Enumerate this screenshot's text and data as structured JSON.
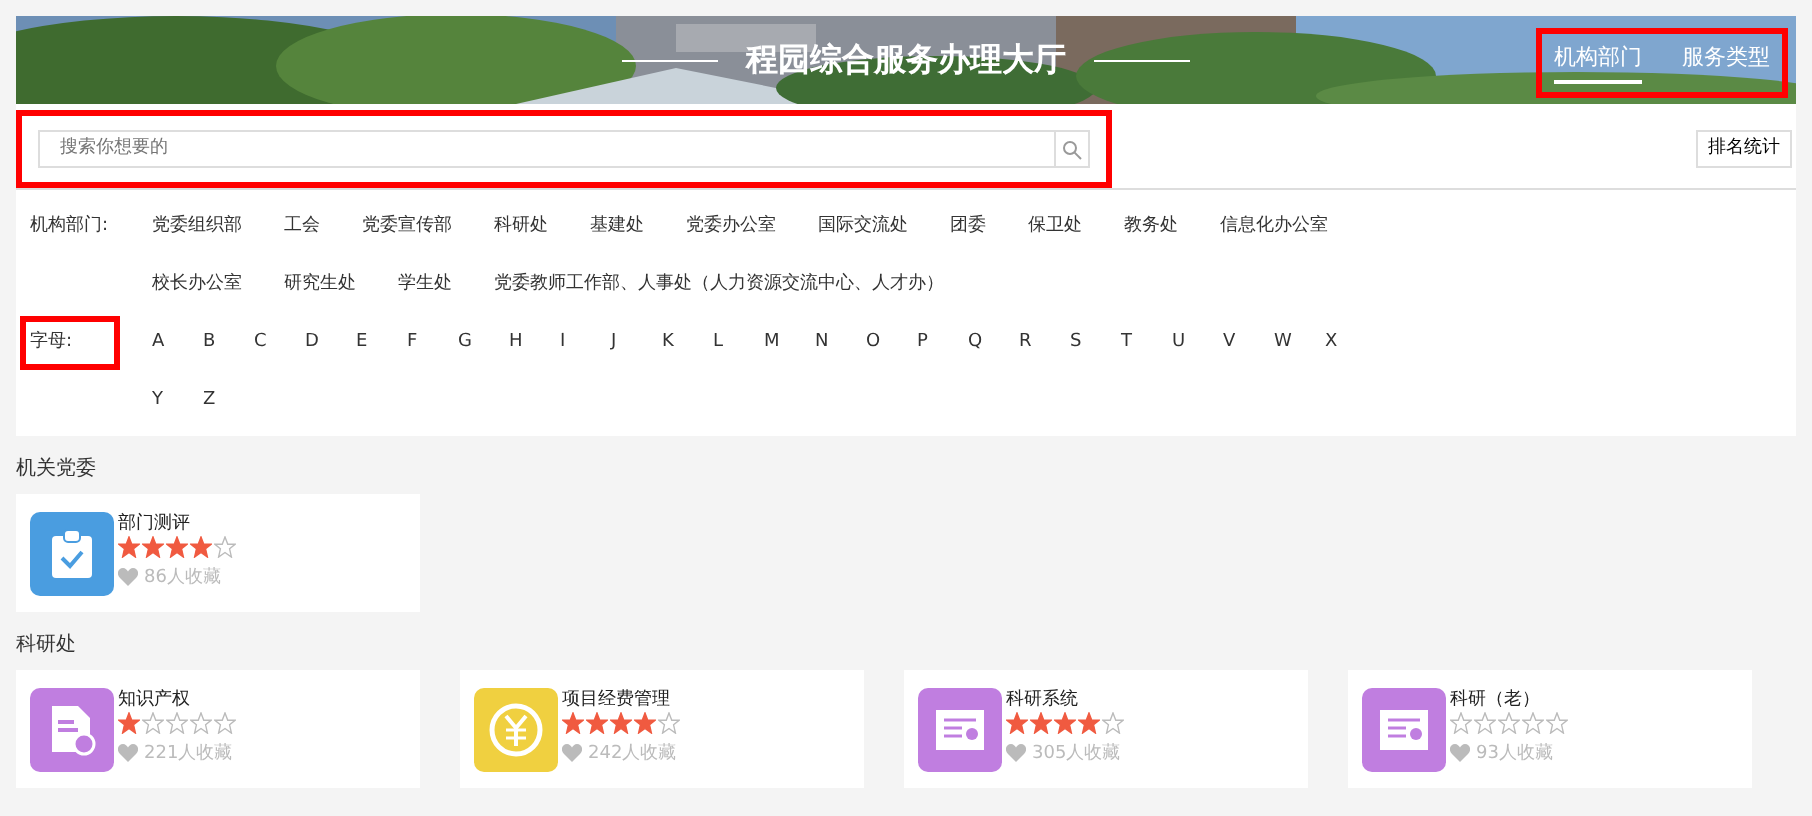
{
  "header": {
    "title": "程园综合服务办理大厅",
    "nav": [
      {
        "label": "机构部门",
        "selected": true
      },
      {
        "label": "服务类型",
        "selected": false
      }
    ],
    "nav_highlighted": true
  },
  "search": {
    "placeholder": "搜索你想要的",
    "highlighted": true
  },
  "ranking_button": "排名统计",
  "filters": [
    {
      "label": "机构部门:",
      "highlighted": false,
      "rows": [
        [
          "党委组织部",
          "工会",
          "党委宣传部",
          "科研处",
          "基建处",
          "党委办公室",
          "国际交流处",
          "团委",
          "保卫处",
          "教务处",
          "信息化办公室"
        ],
        [
          "校长办公室",
          "研究生处",
          "学生处",
          "党委教师工作部、人事处（人力资源交流中心、人才办）"
        ]
      ]
    },
    {
      "label": "字母:",
      "highlighted": true,
      "rows": [
        [
          "A",
          "B",
          "C",
          "D",
          "E",
          "F",
          "G",
          "H",
          "I",
          "J",
          "K",
          "L",
          "M",
          "N",
          "O",
          "P",
          "Q",
          "R",
          "S",
          "T",
          "U",
          "V",
          "W",
          "X"
        ],
        [
          "Y",
          "Z"
        ]
      ]
    }
  ],
  "sections": [
    {
      "title": "机关党委",
      "services": [
        {
          "name": "部门测评",
          "kind": "clipboard",
          "color": "#4a9de0",
          "stars": 4,
          "favorites": "86人收藏"
        }
      ]
    },
    {
      "title": "科研处",
      "services": [
        {
          "name": "知识产权",
          "kind": "document",
          "color": "#c07ee0",
          "stars": 1,
          "favorites": "221人收藏"
        },
        {
          "name": "项目经费管理",
          "kind": "yen",
          "color": "#f0d040",
          "stars": 4,
          "favorites": "242人收藏"
        },
        {
          "name": "科研系统",
          "kind": "certificate",
          "color": "#c07ee0",
          "stars": 4,
          "favorites": "305人收藏"
        },
        {
          "name": "科研（老）",
          "kind": "certificate",
          "color": "#c07ee0",
          "stars": 0,
          "favorites": "93人收藏"
        }
      ]
    }
  ]
}
